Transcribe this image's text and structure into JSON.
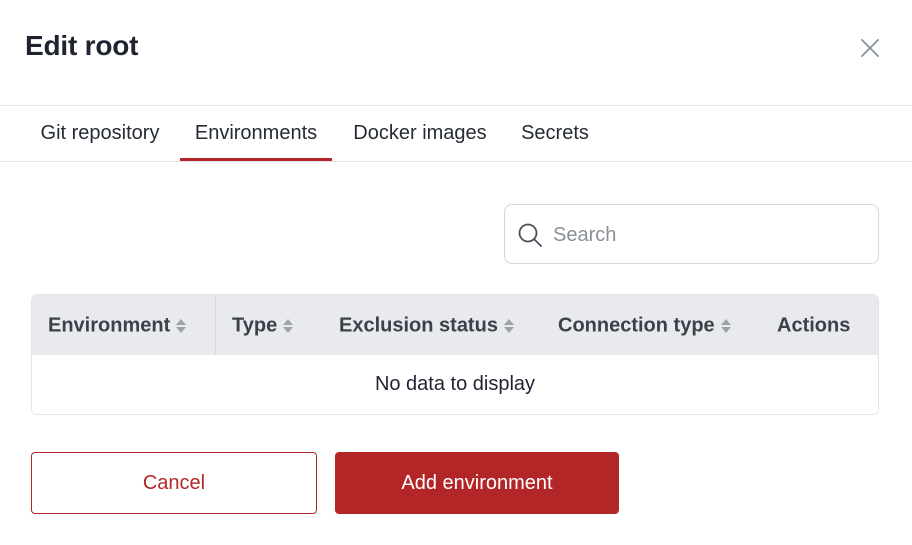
{
  "modal": {
    "title": "Edit root"
  },
  "tabs": [
    {
      "label": "Git repository",
      "active": false
    },
    {
      "label": "Environments",
      "active": true
    },
    {
      "label": "Docker images",
      "active": false
    },
    {
      "label": "Secrets",
      "active": false
    }
  ],
  "search": {
    "placeholder": "Search",
    "value": ""
  },
  "table": {
    "columns": [
      {
        "label": "Environment",
        "sortable": true
      },
      {
        "label": "Type",
        "sortable": true
      },
      {
        "label": "Exclusion status",
        "sortable": true
      },
      {
        "label": "Connection type",
        "sortable": true
      },
      {
        "label": "Actions",
        "sortable": false
      }
    ],
    "empty_message": "No data to display"
  },
  "actions": {
    "cancel_label": "Cancel",
    "add_label": "Add environment"
  },
  "icons": {
    "close": "close-icon",
    "search": "search-icon",
    "sort": "sort-icon"
  },
  "colors": {
    "accent": "#b22627",
    "header_bg": "#e9eaee",
    "text": "#1f2430"
  }
}
